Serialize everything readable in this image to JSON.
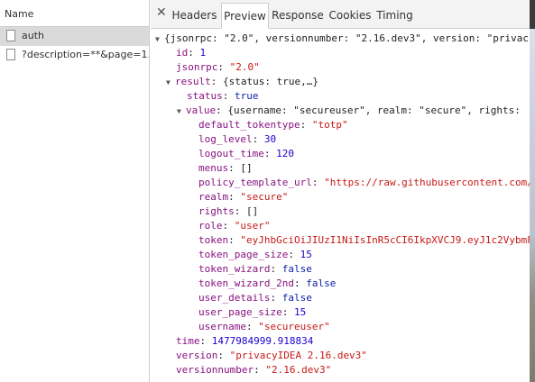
{
  "request_list": {
    "header": "Name",
    "items": [
      {
        "label": "auth",
        "selected": true
      },
      {
        "label": "?description=**&page=1...",
        "selected": false
      }
    ]
  },
  "tabs": [
    {
      "label": "Headers",
      "active": false
    },
    {
      "label": "Preview",
      "active": true
    },
    {
      "label": "Response",
      "active": false
    },
    {
      "label": "Cookies",
      "active": false
    },
    {
      "label": "Timing",
      "active": false
    }
  ],
  "close_glyph": "✕",
  "preview": {
    "root_summary": "{jsonrpc: \"2.0\", versionnumber: \"2.16.dev3\", version: \"privac",
    "id": {
      "key": "id",
      "value": "1"
    },
    "jsonrpc": {
      "key": "jsonrpc",
      "value": "\"2.0\""
    },
    "result": {
      "key": "result",
      "summary": "{status: true,…}"
    },
    "status": {
      "key": "status",
      "value": "true"
    },
    "value": {
      "key": "value",
      "summary": "{username: \"secureuser\", realm: \"secure\", rights:"
    },
    "fields": [
      {
        "key": "default_tokentype",
        "value": "\"totp\"",
        "kind": "s"
      },
      {
        "key": "log_level",
        "value": "30",
        "kind": "n"
      },
      {
        "key": "logout_time",
        "value": "120",
        "kind": "n"
      },
      {
        "key": "menus",
        "value": "[]",
        "kind": "p"
      },
      {
        "key": "policy_template_url",
        "value": "\"https://raw.githubusercontent.com/",
        "kind": "s"
      },
      {
        "key": "realm",
        "value": "\"secure\"",
        "kind": "s"
      },
      {
        "key": "rights",
        "value": "[]",
        "kind": "p"
      },
      {
        "key": "role",
        "value": "\"user\"",
        "kind": "s"
      },
      {
        "key": "token",
        "value": "\"eyJhbGciOiJIUzI1NiIsInR5cCI6IkpXVCJ9.eyJ1c2VybmF",
        "kind": "s"
      },
      {
        "key": "token_page_size",
        "value": "15",
        "kind": "n"
      },
      {
        "key": "token_wizard",
        "value": "false",
        "kind": "b"
      },
      {
        "key": "token_wizard_2nd",
        "value": "false",
        "kind": "b"
      },
      {
        "key": "user_details",
        "value": "false",
        "kind": "b"
      },
      {
        "key": "user_page_size",
        "value": "15",
        "kind": "n"
      },
      {
        "key": "username",
        "value": "\"secureuser\"",
        "kind": "s"
      }
    ],
    "time": {
      "key": "time",
      "value": "1477984999.918834"
    },
    "version": {
      "key": "version",
      "value": "\"privacyIDEA 2.16.dev3\""
    },
    "versionnumber": {
      "key": "versionnumber",
      "value": "\"2.16.dev3\""
    }
  },
  "colors": {
    "key": "#881280",
    "string": "#c41a16",
    "number": "#1c00cf",
    "boolean": "#0d22aa"
  },
  "icons": {
    "expanded": "triangle-down-icon",
    "request": "file-icon",
    "close": "close-icon"
  }
}
